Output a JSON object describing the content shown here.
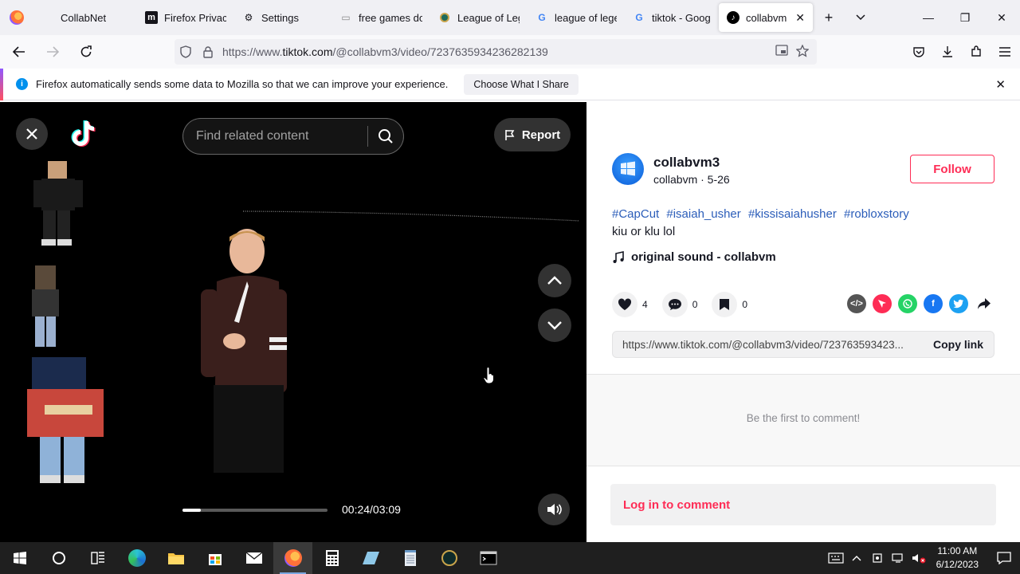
{
  "browser": {
    "tabs": [
      {
        "title": "CollabNet",
        "icon": "firefox-icon",
        "active": false
      },
      {
        "title": "Firefox Privacy",
        "icon": "mozilla-icon",
        "active": false
      },
      {
        "title": "Settings",
        "icon": "gear-icon",
        "active": false
      },
      {
        "title": "free games do",
        "icon": "page-icon",
        "active": false
      },
      {
        "title": "League of Leg",
        "icon": "league-icon",
        "active": false
      },
      {
        "title": "league of leger",
        "icon": "google-icon",
        "active": false
      },
      {
        "title": "tiktok - Google",
        "icon": "google-icon",
        "active": false
      },
      {
        "title": "collabvm (@",
        "icon": "tiktok-icon",
        "active": true
      }
    ],
    "url_prefix": "https://www.",
    "url_host": "tiktok.com",
    "url_path": "/@collabvm3/video/7237635934236282139",
    "notification": {
      "message": "Firefox automatically sends some data to Mozilla so that we can improve your experience.",
      "button": "Choose What I Share"
    }
  },
  "video": {
    "search_placeholder": "Find related content",
    "report_label": "Report",
    "time": "00:24/03:09",
    "progress_fraction": 0.127
  },
  "post": {
    "username": "collabvm3",
    "subline": "collabvm · 5-26",
    "follow_label": "Follow",
    "hashtags": [
      "#CapCut",
      "#isaiah_usher",
      "#kissisaiahusher",
      "#robloxstory"
    ],
    "caption": "kiu or klu lol",
    "sound": "original sound - collabvm",
    "likes": "4",
    "comments": "0",
    "saves": "0",
    "link": "https://www.tiktok.com/@collabvm3/video/723763593423...",
    "copy_label": "Copy link",
    "empty_comments": "Be the first to comment!",
    "login_label": "Log in to comment",
    "share_colors": {
      "embed": "#555555",
      "friends": "#fe2c55",
      "whatsapp": "#25d366",
      "facebook": "#1877f2",
      "twitter": "#1da1f2"
    }
  },
  "taskbar": {
    "time": "11:00 AM",
    "date": "6/12/2023"
  }
}
